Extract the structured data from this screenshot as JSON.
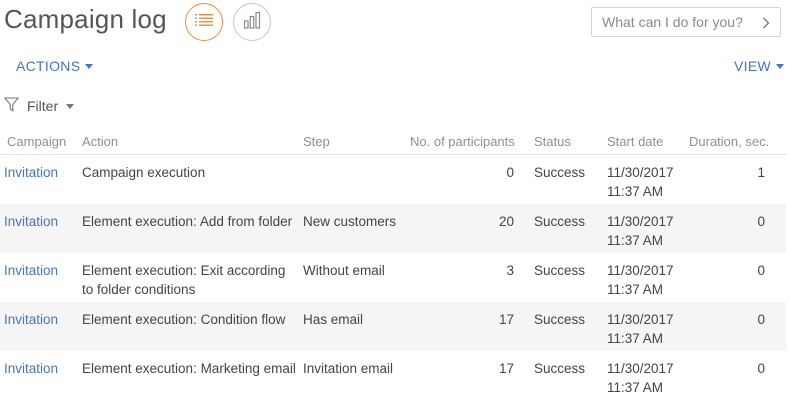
{
  "page": {
    "title": "Campaign log"
  },
  "views": {
    "list_icon": "list-icon",
    "chart_icon": "bar-chart-icon"
  },
  "search": {
    "placeholder": "What can I do for you?"
  },
  "toolbar": {
    "actions_label": "ACTIONS",
    "view_label": "VIEW"
  },
  "filter": {
    "label": "Filter"
  },
  "colors": {
    "accent": "#f08a3c",
    "link": "#4a74b9",
    "alt_row": "#f5f5f5"
  },
  "grid": {
    "headers": {
      "campaign": "Campaign",
      "action": "Action",
      "step": "Step",
      "participants": "No. of participants",
      "status": "Status",
      "start_date": "Start date",
      "duration": "Duration, sec."
    },
    "rows": [
      {
        "campaign": "Invitation",
        "action": "Campaign execution",
        "step": "",
        "participants": "0",
        "status": "Success",
        "date": "11/30/2017",
        "time": "11:37 AM",
        "duration": "1"
      },
      {
        "campaign": "Invitation",
        "action": "Element execution: Add from folder",
        "step": "New customers",
        "participants": "20",
        "status": "Success",
        "date": "11/30/2017",
        "time": "11:37 AM",
        "duration": "0"
      },
      {
        "campaign": "Invitation",
        "action": "Element execution: Exit according to folder conditions",
        "step": "Without email",
        "participants": "3",
        "status": "Success",
        "date": "11/30/2017",
        "time": "11:37 AM",
        "duration": "0"
      },
      {
        "campaign": "Invitation",
        "action": "Element execution: Condition flow",
        "step": "Has email",
        "participants": "17",
        "status": "Success",
        "date": "11/30/2017",
        "time": "11:37 AM",
        "duration": "0"
      },
      {
        "campaign": "Invitation",
        "action": "Element execution: Marketing email",
        "step": "Invitation email",
        "participants": "17",
        "status": "Success",
        "date": "11/30/2017",
        "time": "11:37 AM",
        "duration": "0"
      }
    ]
  }
}
